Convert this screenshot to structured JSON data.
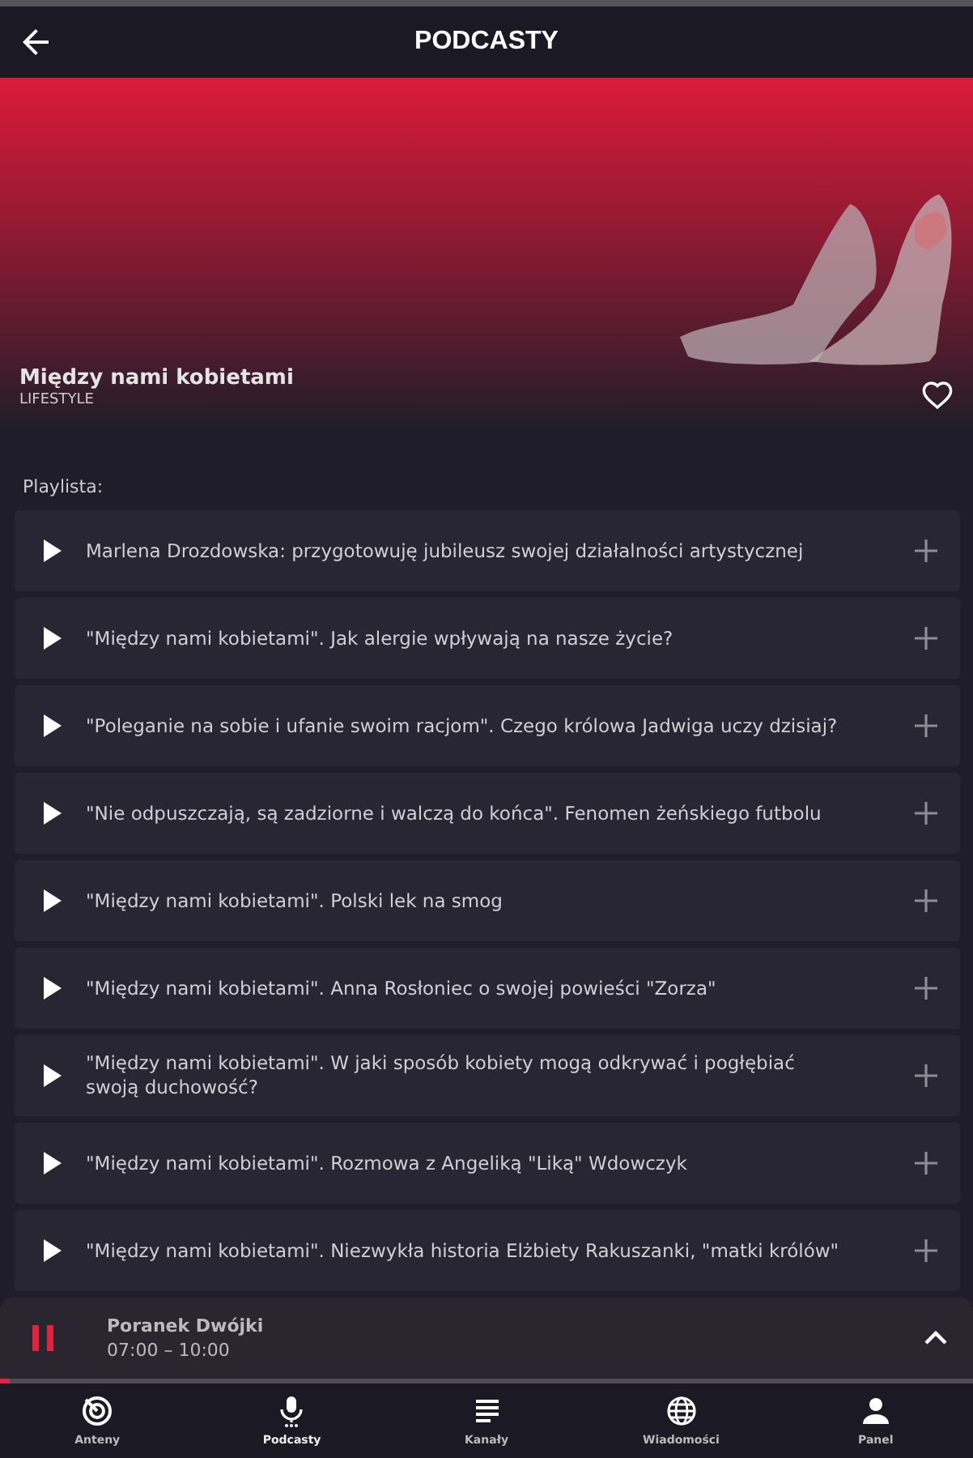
{
  "header": {
    "title": "PODCASTY"
  },
  "podcast": {
    "title": "Między nami kobietami",
    "category": "LIFESTYLE",
    "favorite": false
  },
  "playlist": {
    "label": "Playlista:",
    "items": [
      {
        "title": "Marlena Drozdowska: przygotowuję jubileusz swojej działalności artystycznej"
      },
      {
        "title": "\"Między nami kobietami\". Jak alergie wpływają na nasze życie?"
      },
      {
        "title": "\"Poleganie na sobie i ufanie swoim racjom\". Czego królowa Jadwiga uczy dzisiaj?"
      },
      {
        "title": "\"Nie odpuszczają, są zadziorne i walczą do końca\". Fenomen żeńskiego futbolu"
      },
      {
        "title": "\"Między nami kobietami\". Polski lek na smog"
      },
      {
        "title": "\"Między nami kobietami\". Anna Rosłoniec o swojej powieści \"Zorza\""
      },
      {
        "title": "\"Między nami kobietami\". W jaki sposób kobiety mogą odkrywać i pogłębiać swoją duchowość?"
      },
      {
        "title": "\"Między nami kobietami\". Rozmowa z Angeliką \"Liką\" Wdowczyk"
      },
      {
        "title": "\"Między nami kobietami\". Niezwykła historia Elżbiety Rakuszanki, \"matki królów\""
      }
    ]
  },
  "player": {
    "title": "Poranek Dwójki",
    "time": "07:00 – 10:00",
    "playing": true,
    "level": 0.01
  },
  "nav": [
    {
      "label": "Anteny",
      "kind": "antenna",
      "selected": false
    },
    {
      "label": "Podcasty",
      "kind": "mic",
      "selected": true
    },
    {
      "label": "Kanały",
      "kind": "lines",
      "selected": false
    },
    {
      "label": "Wiadomości",
      "kind": "globe",
      "selected": false
    },
    {
      "label": "Panel",
      "kind": "person",
      "selected": false
    }
  ]
}
